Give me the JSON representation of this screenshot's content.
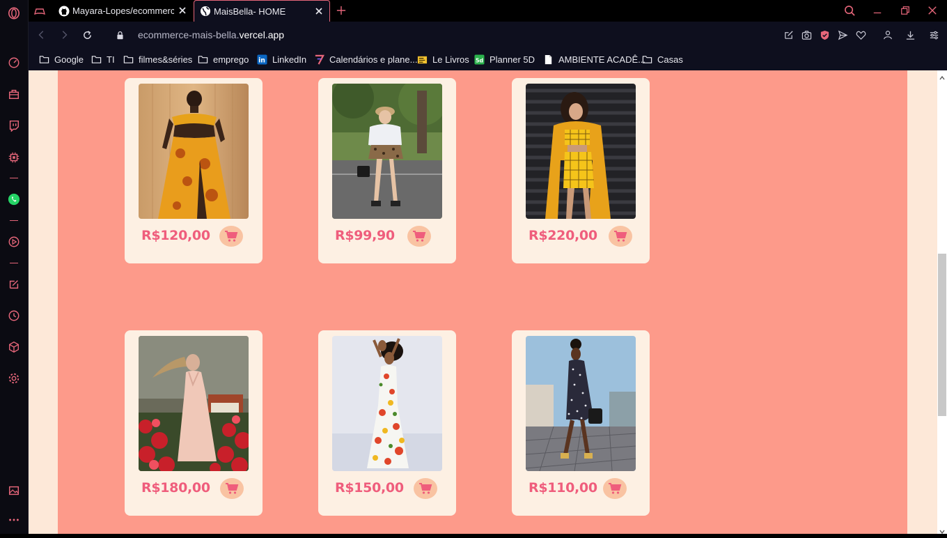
{
  "browser": {
    "tabs": [
      {
        "title": "",
        "icon": "gamepad-icon"
      },
      {
        "title": "Mayara-Lopes/ecommerce",
        "icon": "github-icon"
      },
      {
        "title": "MaisBella- HOME",
        "icon": "globe-icon"
      }
    ],
    "url_prefix": "ecommerce-mais-bella.",
    "url_domain": "vercel.app"
  },
  "bookmarks": [
    {
      "label": "Google",
      "icon": "folder-icon"
    },
    {
      "label": "TI",
      "icon": "folder-icon"
    },
    {
      "label": "filmes&séries",
      "icon": "folder-icon"
    },
    {
      "label": "emprego",
      "icon": "folder-icon"
    },
    {
      "label": "LinkedIn",
      "icon": "linkedin-icon"
    },
    {
      "label": "Calendários e plane...",
      "icon": "calendar-logo-icon"
    },
    {
      "label": "Le Livros",
      "icon": "book-icon"
    },
    {
      "label": "Planner 5D",
      "icon": "planner5d-icon"
    },
    {
      "label": "AMBIENTE ACADÊ...",
      "icon": "document-icon"
    },
    {
      "label": "Casas",
      "icon": "folder-icon"
    }
  ],
  "products": [
    {
      "price": "R$120,00",
      "image": "woman-in-yellow-african-print-dress"
    },
    {
      "price": "R$99,90",
      "image": "woman-in-white-top-and-leopard-shorts"
    },
    {
      "price": "R$220,00",
      "image": "woman-in-yellow-plaid-set"
    },
    {
      "price": "R$180,00",
      "image": "woman-in-pink-dress-among-flowers"
    },
    {
      "price": "R$150,00",
      "image": "woman-in-white-floral-dress"
    },
    {
      "price": "R$110,00",
      "image": "woman-in-polka-dot-dress"
    }
  ],
  "colors": {
    "page_background": "#fd9a8a",
    "card_background": "#fdf0e3",
    "price_text": "#ef5d7c",
    "cart_button": "#f9c3a2",
    "browser_accent": "#e6667a"
  }
}
